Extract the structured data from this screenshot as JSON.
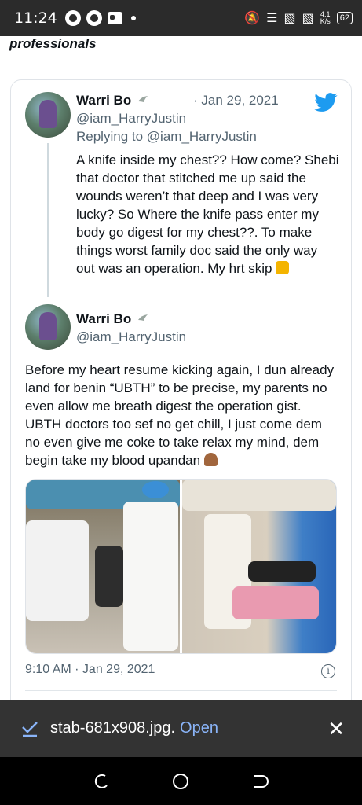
{
  "status_bar": {
    "time": "11:24",
    "battery": "62",
    "net_speed_top": "4.1",
    "net_speed_bottom": "K/s",
    "icons": [
      "chrome-icon",
      "chrome-icon",
      "message-icon",
      "mute-icon",
      "wifi-icon",
      "signal-icon",
      "signal-icon",
      "battery-icon"
    ]
  },
  "page_heading": "professionals",
  "tweets": [
    {
      "name": "Warri Bo",
      "name_badge_icon": "dove-icon",
      "handle": "@iam_HarryJustin",
      "separator": "·",
      "date": "Jan 29, 2021",
      "reply_prefix": "Replying to",
      "reply_to": "@iam_HarryJustin",
      "text": "A knife inside my chest?? How come? Shebi that doctor that stitched me up said the wounds weren’t that deep and I was very lucky? So Where the knife pass enter my body go digest for my chest??. To make things worst family doc said the only way out was an operation. My hrt skip",
      "trailing_emoji": "scream-emoji"
    },
    {
      "name": "Warri Bo",
      "name_badge_icon": "dove-icon",
      "handle": "@iam_HarryJustin",
      "text": "Before my heart resume kicking again, I dun already land for benin “UBTH” to be precise, my parents no even allow me breath digest the operation gist. UBTH doctors too sef no get chill, I just come dem no even give me coke to take relax my mind, dem begin take my blood upandan",
      "trailing_emoji": "person-facepalming-emoji",
      "timestamp": "9:10 AM · Jan 29, 2021"
    }
  ],
  "brand_icon": "twitter-bird-icon",
  "download_bar": {
    "filename": "stab-681x908.jpg.",
    "action": "Open"
  },
  "nav_bar": [
    "recents-icon",
    "home-icon",
    "back-icon"
  ],
  "colors": {
    "twitter_blue": "#1d9bf0",
    "link_blue": "#8ab4f8",
    "muted_text": "#536471"
  }
}
